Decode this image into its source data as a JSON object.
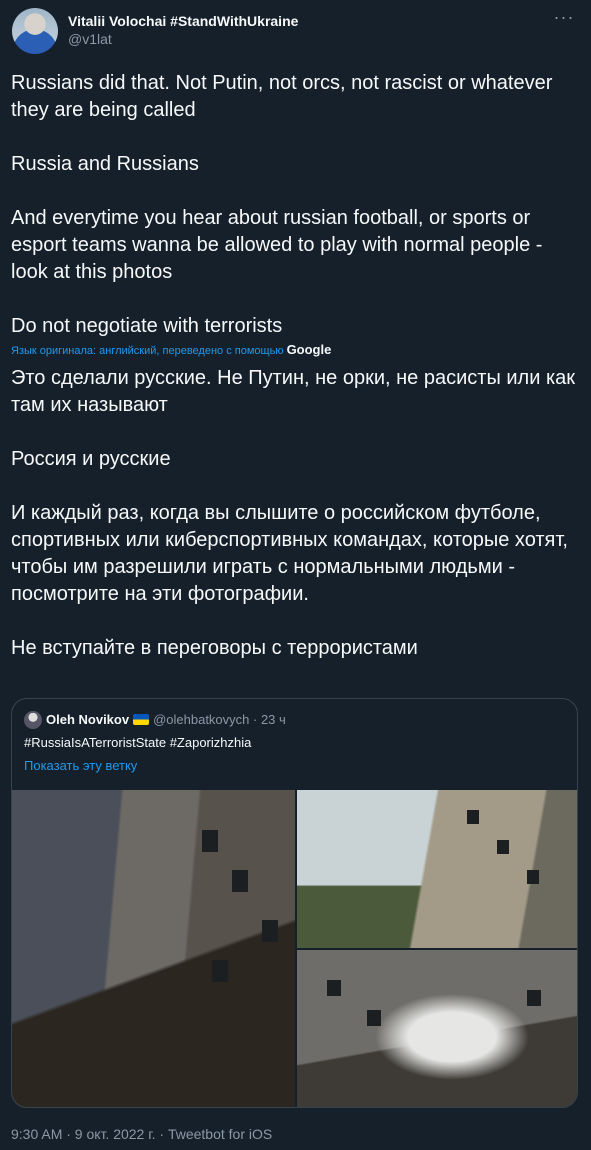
{
  "author": {
    "name": "Vitalii Volochai #StandWithUkraine",
    "handle": "@v1lat",
    "more_icon": "more-horizontal-icon"
  },
  "tweet": {
    "text": "Russians did that. Not Putin, not orcs, not rascist or whatever they are being called\n\nRussia and Russians\n\nAnd everytime you hear about russian football, or sports or esport teams wanna be allowed to play with normal people - look at this photos\n\nDo not negotiate with terrorists",
    "translation_note": "Язык оригинала: английский, переведено с помощью",
    "translation_provider": "Google",
    "translated_text": "Это сделали русские. Не Путин, не орки, не расисты или как там их называют\n\nРоссия и русские\n\nИ каждый раз, когда вы слышите о российском футболе, спортивных или киберспортивных командах, которые хотят, чтобы им разрешили играть с нормальными людьми - посмотрите на эти фотографии.\n\nНе вступайте в переговоры с террористами"
  },
  "quoted": {
    "name": "Oleh Novikov",
    "handle_time": "@olehbatkovych · 23 ч",
    "text": "#RussiaIsATerroristState #Zaporizhzhia",
    "show_thread": "Показать эту ветку"
  },
  "footer": {
    "meta": "9:30 AM · 9 окт. 2022 г. · Tweetbot for iOS"
  },
  "colors": {
    "background": "#15202b",
    "link": "#1d9bf0",
    "secondary_text": "#8b98a5",
    "border": "#38444d"
  }
}
